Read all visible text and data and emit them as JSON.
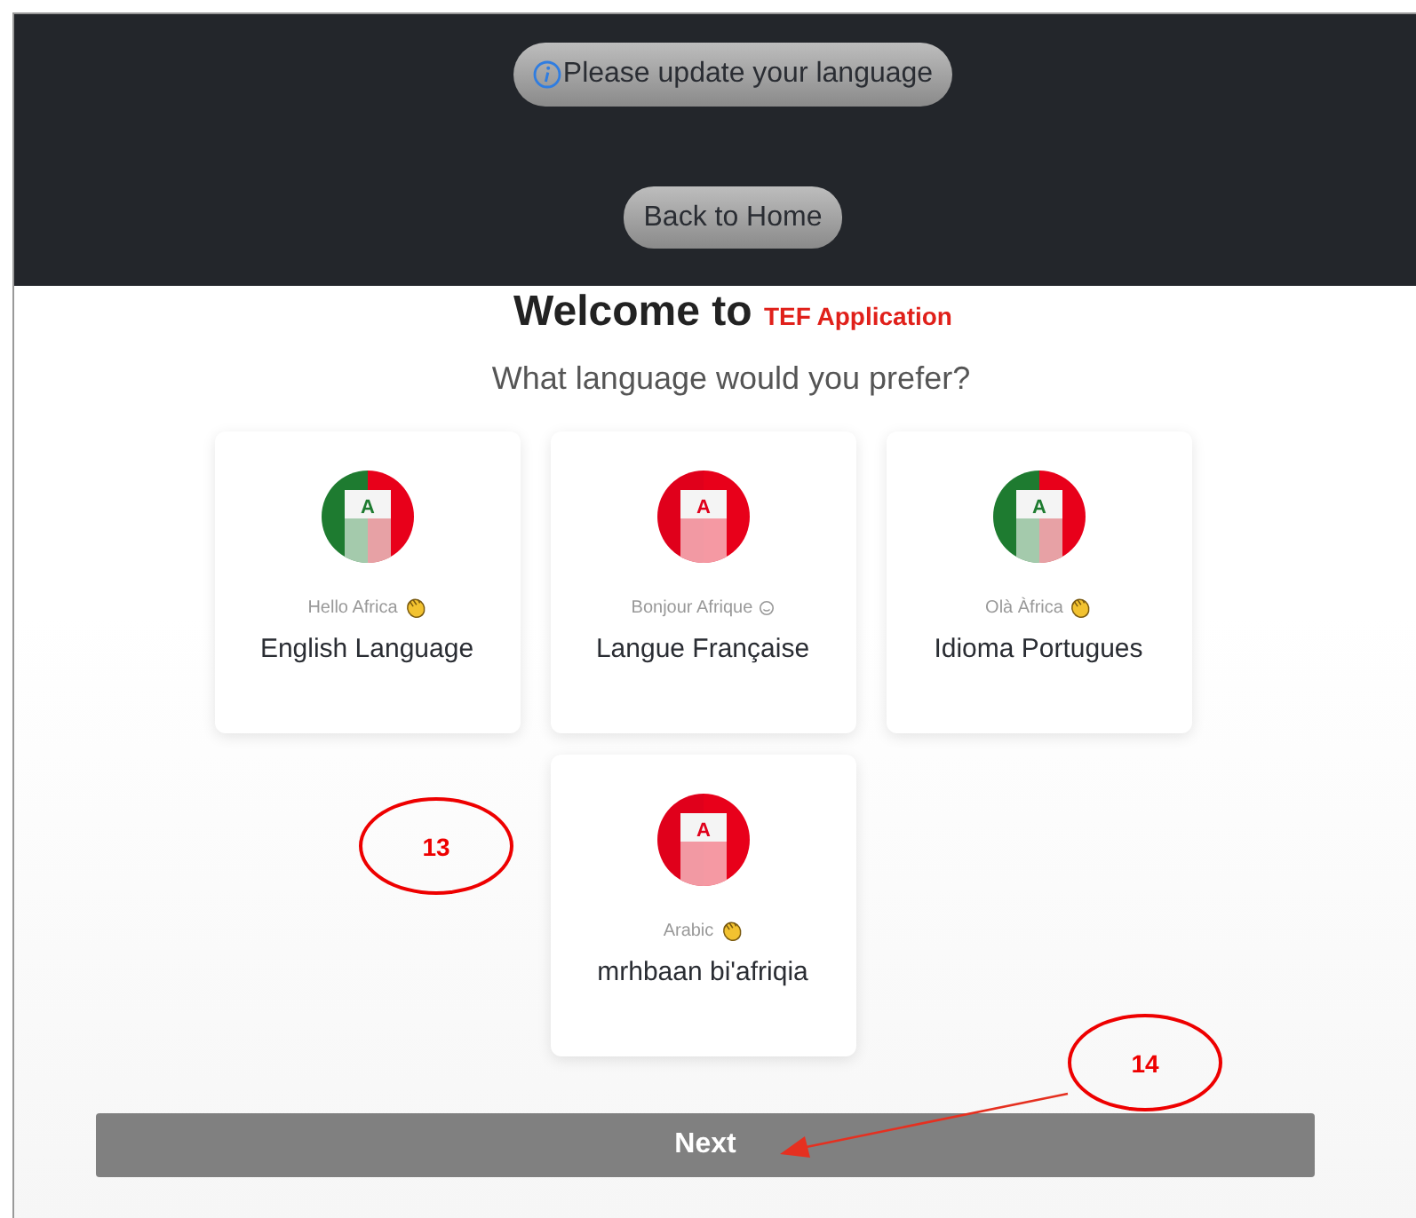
{
  "header": {
    "notice": "Please update your language",
    "back_button": "Back to Home"
  },
  "welcome": {
    "title": "Welcome to",
    "app_name": "TEF Application",
    "question": "What language would you prefer?"
  },
  "languages": [
    {
      "letter": "A",
      "color": "#1e7b30",
      "greeting": "Hello Africa",
      "kind": "hand",
      "name": "English Language"
    },
    {
      "letter": "A",
      "color": "#e0001b",
      "greeting": "Bonjour Afrique",
      "kind": "smile",
      "name": "Langue Française"
    },
    {
      "letter": "A",
      "color": "#1e7b30",
      "greeting": "Olà Àfrica",
      "kind": "hand",
      "name": "Idioma Portugues"
    },
    {
      "letter": "A",
      "color": "#e0001b",
      "greeting": "Arabic",
      "kind": "hand",
      "name": "mrhbaan bi'afriqia"
    }
  ],
  "next_button": "Next",
  "annotations": [
    {
      "label": "13"
    },
    {
      "label": "14",
      "arrow": true
    }
  ]
}
